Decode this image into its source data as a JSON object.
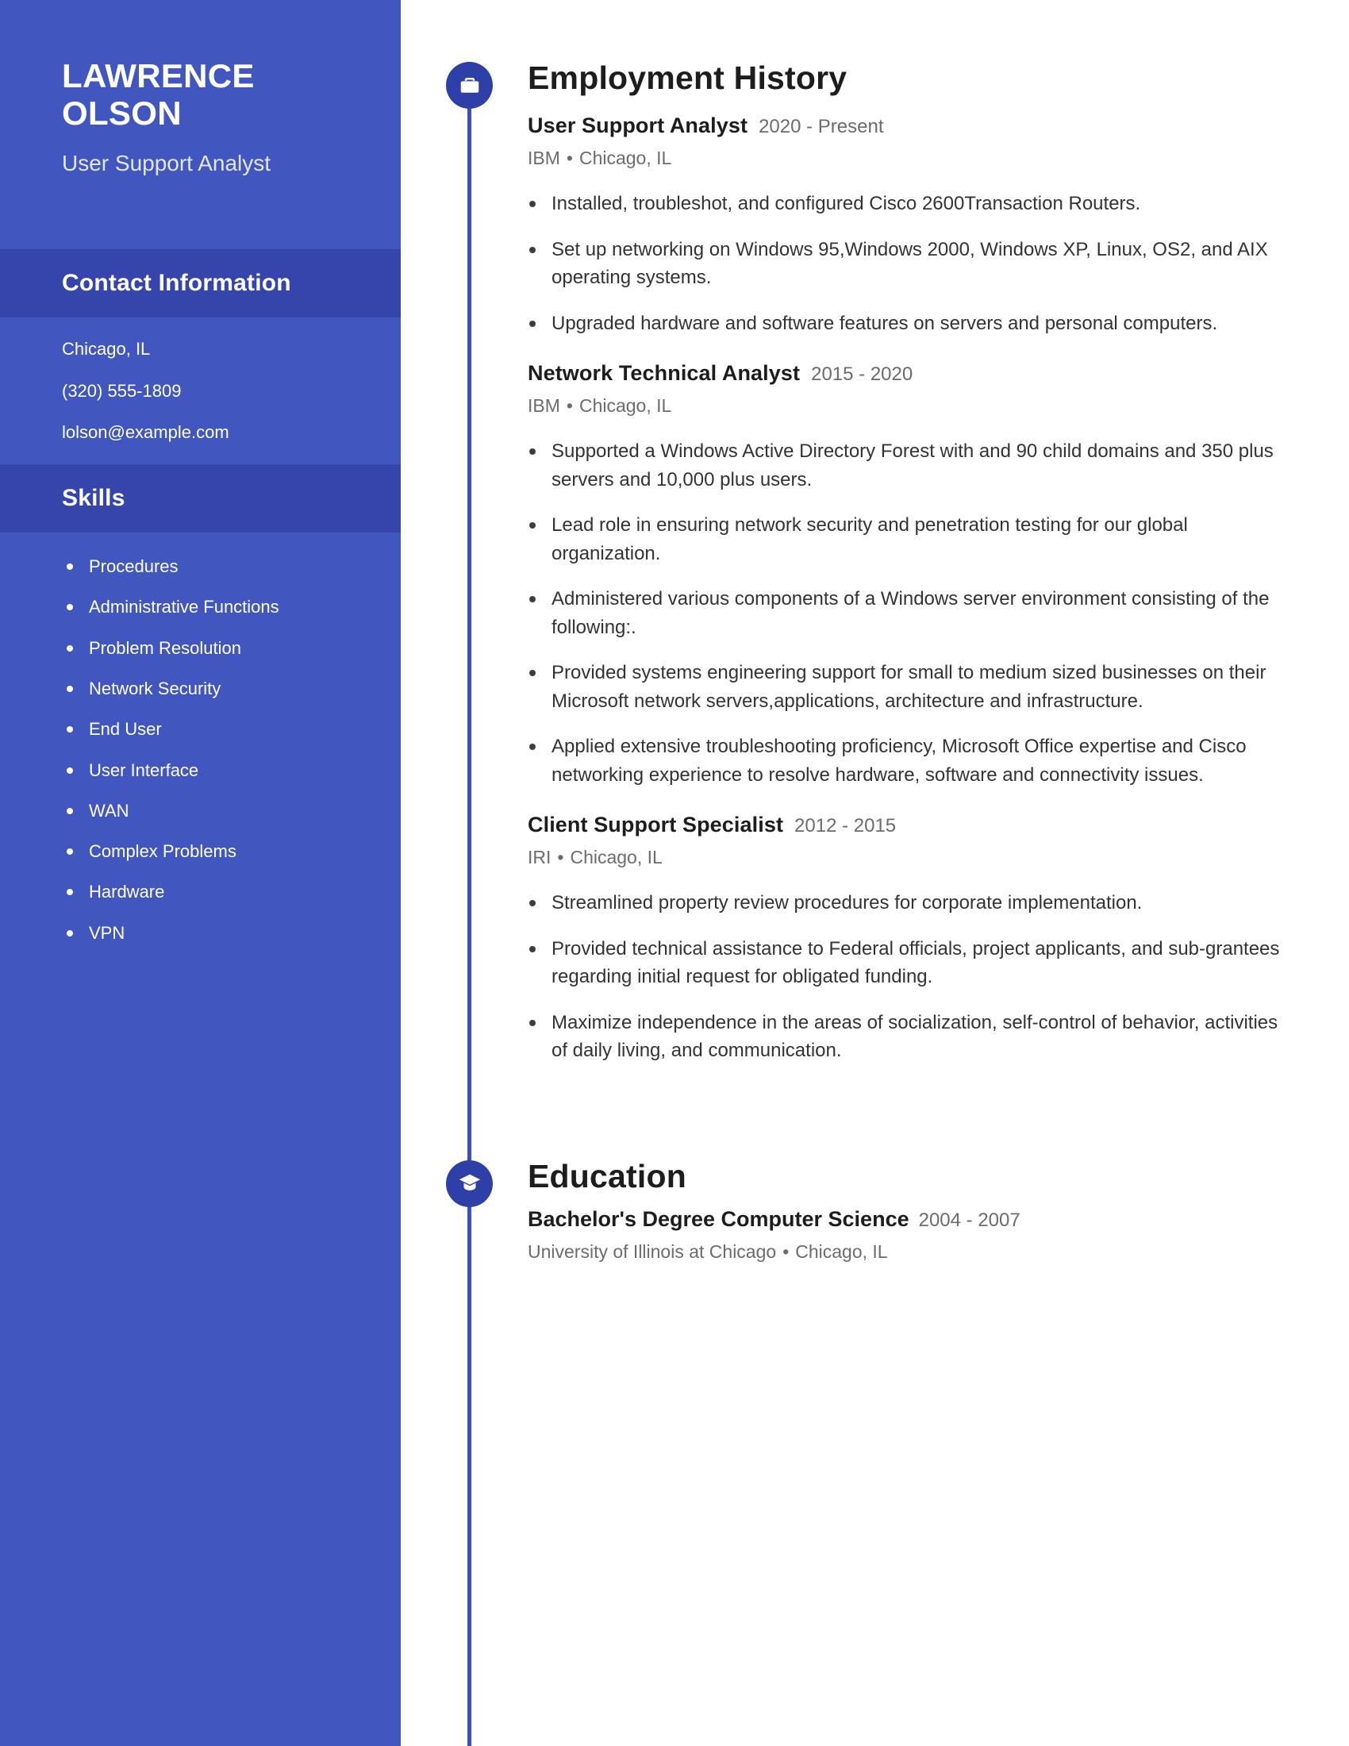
{
  "sidebar": {
    "first_name": "LAWRENCE",
    "last_name": "OLSON",
    "headline": "User Support Analyst",
    "contact": {
      "heading": "Contact Information",
      "location": "Chicago, IL",
      "phone": "(320) 555-1809",
      "email": "lolson@example.com"
    },
    "skills": {
      "heading": "Skills",
      "items": [
        "Procedures",
        "Administrative Functions",
        "Problem Resolution",
        "Network Security",
        "End User",
        "User Interface",
        "WAN",
        "Complex Problems",
        "Hardware",
        "VPN"
      ]
    },
    "colors": {
      "background": "#4256c0",
      "section_band": "#3545ab",
      "text": "#ffffff",
      "headline_text": "#e2e6f7"
    }
  },
  "main": {
    "employment": {
      "title": "Employment History",
      "icon": "briefcase-icon",
      "entries": [
        {
          "role": "User Support Analyst",
          "dates": "2020 - Present",
          "company": "IBM",
          "location": "Chicago, IL",
          "bullets": [
            "Installed, troubleshot, and configured Cisco 2600Transaction Routers.",
            "Set up networking on Windows 95,Windows 2000, Windows XP, Linux, OS2, and AIX operating systems.",
            "Upgraded hardware and software features on servers and personal computers."
          ]
        },
        {
          "role": "Network Technical Analyst",
          "dates": "2015 - 2020",
          "company": "IBM",
          "location": "Chicago, IL",
          "bullets": [
            "Supported a Windows Active Directory Forest with and 90 child domains and 350 plus servers and 10,000 plus users.",
            "Lead role in ensuring network security and penetration testing for our global organization.",
            "Administered various components of a Windows server environment consisting of the following:.",
            "Provided systems engineering support for small to medium sized businesses on their Microsoft network servers,applications, architecture and infrastructure.",
            "Applied extensive troubleshooting proficiency, Microsoft Office expertise and Cisco networking experience to resolve hardware, software and connectivity issues."
          ]
        },
        {
          "role": "Client Support Specialist",
          "dates": "2012 - 2015",
          "company": "IRI",
          "location": "Chicago, IL",
          "bullets": [
            "Streamlined property review procedures for corporate implementation.",
            "Provided technical assistance to Federal officials, project applicants, and sub-grantees regarding initial request for obligated funding.",
            "Maximize independence in the areas of socialization, self-control of behavior, activities of daily living, and communication."
          ]
        }
      ]
    },
    "education": {
      "title": "Education",
      "icon": "graduation-cap-icon",
      "entries": [
        {
          "degree": "Bachelor's Degree Computer Science",
          "dates": "2004 - 2007",
          "school": "University of Illinois at Chicago",
          "location": "Chicago, IL"
        }
      ]
    },
    "separator": "•",
    "colors": {
      "node_circle": "#2f3fa8",
      "timeline_line": "#3b4fbe",
      "heading_text": "#1d1d1d",
      "body_text": "#333333",
      "muted_text": "#6c6c6c"
    }
  }
}
